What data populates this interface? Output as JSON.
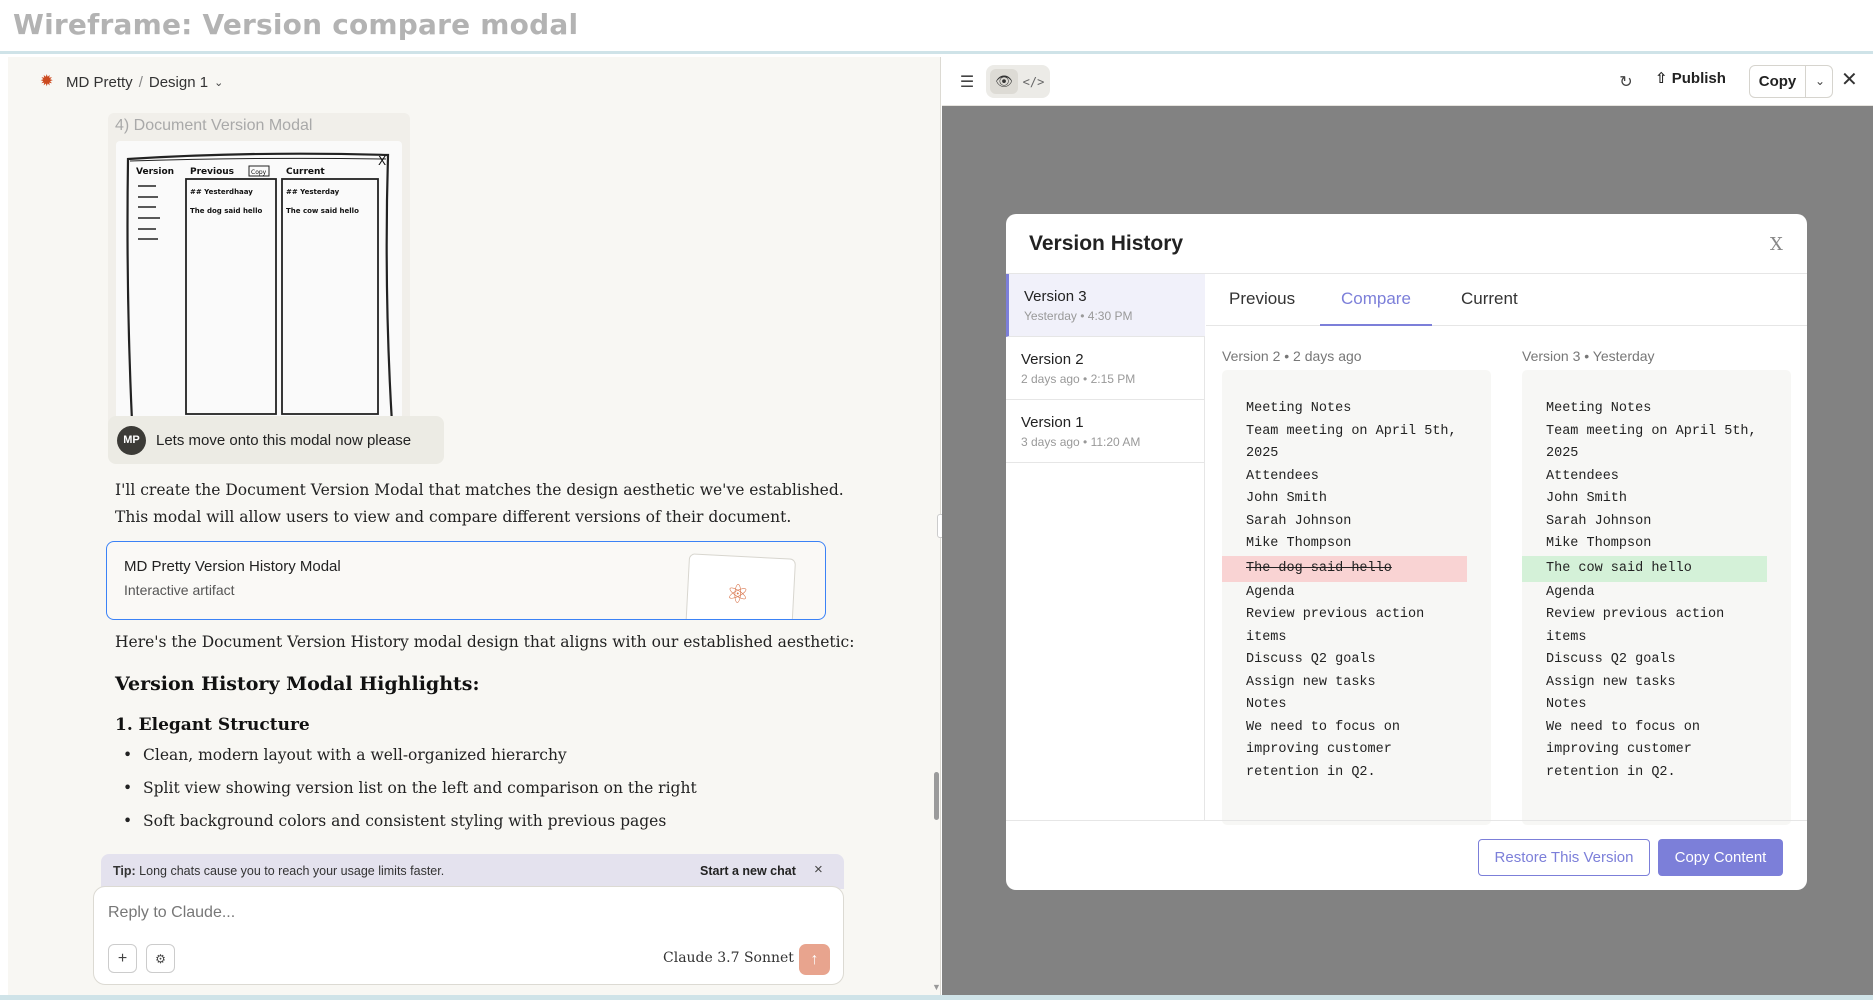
{
  "wireframe_title": "Wireframe: Version compare modal",
  "breadcrumb": {
    "project": "MD Pretty",
    "separator": "/",
    "doc": "Design 1"
  },
  "sketch": {
    "caption": "4) Document Version Modal",
    "col_version": "Version",
    "col_previous": "Previous",
    "col_current": "Current",
    "copy_label": "Copy",
    "prev_heading": "## Yesterdhaay",
    "prev_line": "The dog said hello",
    "cur_heading": "## Yesterday",
    "cur_line": "The cow said hello"
  },
  "user_message": {
    "initials": "MP",
    "text": "Lets move onto this modal now please"
  },
  "assistant": {
    "intro_line1": "I'll create the Document Version Modal that matches the design aesthetic we've established.",
    "intro_line2": "This modal will allow users to view and compare different versions of their document.",
    "artifact_title": "MD Pretty Version History Modal",
    "artifact_subtitle": "Interactive artifact",
    "summary": "Here's the Document Version History modal design that aligns with our established aesthetic:",
    "heading": "Version History Modal Highlights:",
    "subheading": "1. Elegant Structure",
    "bullets": [
      "Clean, modern layout with a well-organized hierarchy",
      "Split view showing version list on the left and comparison on the right",
      "Soft background colors and consistent styling with previous pages"
    ]
  },
  "tip": {
    "label": "Tip:",
    "text": "Long chats cause you to reach your usage limits faster.",
    "action": "Start a new chat",
    "close": "×"
  },
  "composer": {
    "placeholder": "Reply to Claude...",
    "model": "Claude 3.7 Sonnet"
  },
  "artifact_toolbar": {
    "publish": "Publish",
    "copy": "Copy"
  },
  "modal": {
    "title": "Version History",
    "close": "X",
    "versions": [
      {
        "name": "Version 3",
        "date": "Yesterday • 4:30 PM"
      },
      {
        "name": "Version 2",
        "date": "2 days ago • 2:15 PM"
      },
      {
        "name": "Version 1",
        "date": "3 days ago • 11:20 AM"
      }
    ],
    "tabs": [
      "Previous",
      "Compare",
      "Current"
    ],
    "active_tab": "Compare",
    "left_header": "Version 2 • 2 days ago",
    "right_header": "Version 3 • Yesterday",
    "left_lines": [
      "Meeting Notes",
      "Team meeting on April 5th,",
      "2025",
      "Attendees",
      "John Smith",
      "Sarah Johnson",
      "Mike Thompson",
      "The dog said hello",
      "Agenda",
      "Review previous action",
      "items",
      "Discuss Q2 goals",
      "Assign new tasks",
      "Notes",
      "We need to focus on",
      "improving customer",
      "retention in Q2."
    ],
    "right_lines": [
      "Meeting Notes",
      "Team meeting on April 5th,",
      "2025",
      "Attendees",
      "John Smith",
      "Sarah Johnson",
      "Mike Thompson",
      "The cow said hello",
      "Agenda",
      "Review previous action",
      "items",
      "Discuss Q2 goals",
      "Assign new tasks",
      "Notes",
      "We need to focus on",
      "improving customer",
      "retention in Q2."
    ],
    "restore_button": "Restore This Version",
    "copy_button": "Copy Content"
  },
  "colors": {
    "accent": "#7c7fd9",
    "diff_removed": "#f9d3d3",
    "diff_added": "#d4f1d8",
    "artifact_border": "#3b82f6",
    "send": "#e8a48e"
  }
}
